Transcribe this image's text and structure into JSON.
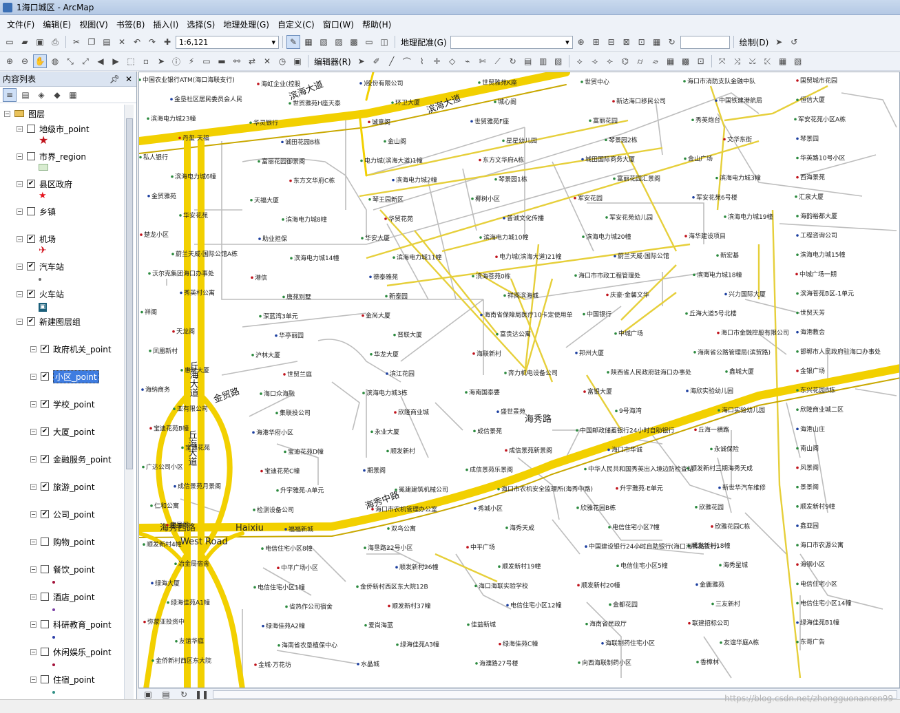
{
  "window": {
    "title": "1海口城区 - ArcMap"
  },
  "menu": [
    "文件(F)",
    "编辑(E)",
    "视图(V)",
    "书签(B)",
    "插入(I)",
    "选择(S)",
    "地理处理(G)",
    "自定义(C)",
    "窗口(W)",
    "帮助(H)"
  ],
  "toolbar": {
    "scale": "1:6,121",
    "georef_label": "地理配准(G)",
    "draw_label": "绘制(D)",
    "editor_label": "编辑器(R)"
  },
  "toc": {
    "title": "内容列表",
    "pin": "ᵠ",
    "close": "✕",
    "root": "图层",
    "layers": [
      {
        "name": "地级市_point",
        "checked": false,
        "symbol": "red-star"
      },
      {
        "name": "市界_region",
        "checked": false,
        "symbol": "green-rect"
      },
      {
        "name": "县区政府",
        "checked": true,
        "symbol": "red-star-small"
      },
      {
        "name": "乡镇",
        "checked": false,
        "symbol": "none"
      },
      {
        "name": "机场",
        "checked": true,
        "symbol": "airplane"
      },
      {
        "name": "汽车站",
        "checked": true,
        "symbol": "dot-gray"
      },
      {
        "name": "火车站",
        "checked": true,
        "symbol": "train"
      },
      {
        "name": "新建图层组",
        "checked": true,
        "symbol": "none"
      },
      {
        "name": "政府机关_point",
        "checked": true,
        "symbol": "none",
        "indent": true
      },
      {
        "name": "小区_point",
        "checked": true,
        "symbol": "none",
        "indent": true,
        "selected": true
      },
      {
        "name": "学校_point",
        "checked": true,
        "symbol": "none",
        "indent": true
      },
      {
        "name": "大厦_point",
        "checked": true,
        "symbol": "none",
        "indent": true
      },
      {
        "name": "金融服务_point",
        "checked": true,
        "symbol": "none",
        "indent": true
      },
      {
        "name": "旅游_point",
        "checked": true,
        "symbol": "none",
        "indent": true
      },
      {
        "name": "公司_point",
        "checked": true,
        "symbol": "none",
        "indent": true
      },
      {
        "name": "购物_point",
        "checked": false,
        "symbol": "none",
        "indent": true
      },
      {
        "name": "餐饮_point",
        "checked": false,
        "symbol": "dot-red",
        "indent": true
      },
      {
        "name": "酒店_point",
        "checked": false,
        "symbol": "dot-purple",
        "indent": true
      },
      {
        "name": "科研教育_point",
        "checked": false,
        "symbol": "dot-blue",
        "indent": true
      },
      {
        "name": "休闲娱乐_point",
        "checked": false,
        "symbol": "dot-red",
        "indent": true
      },
      {
        "name": "住宿_point",
        "checked": false,
        "symbol": "dot-teal",
        "indent": true
      },
      {
        "name": "高速",
        "checked": true,
        "symbol": "none"
      }
    ]
  },
  "map": {
    "road_labels": [
      {
        "text": "滨海大道",
        "rot": -22
      },
      {
        "text": "滨海大道",
        "rot": -22
      },
      {
        "text": "海秀中路",
        "rot": -20
      },
      {
        "text": "海秀西路",
        "rot": 0
      },
      {
        "text": "Haixiu",
        "rot": 0
      },
      {
        "text": "West Road",
        "rot": 0
      },
      {
        "text": "丘海大道",
        "rot": 90
      },
      {
        "text": "丘海大道",
        "rot": 90
      },
      {
        "text": "海秀路",
        "rot": 0
      },
      {
        "text": "金贸路",
        "rot": -20
      }
    ],
    "poi_labels": [
      "中国农业银行ATM(海口海联支行)",
      "海虹企业(控股",
      ")股份有限公司",
      "世贸雅苑K座",
      "世贸中心",
      "海口市消防支队金融中队",
      "国贸城市花园",
      "金垦社区居民委员会人民",
      "世贸雅苑H座天泰",
      "环卫大厦",
      "城心阁",
      "新达海口移民公司",
      "中国铁建港航局",
      "恒信大厦",
      "滨海电力城23幢",
      "华灵银行",
      "诚意阁",
      "世贸雅苑F座",
      "富丽花园",
      "秀英炮台",
      "军安花苑小区A栋",
      "丹玺·天福",
      "诚田花园B栋",
      "金山阁",
      "星星幼儿园",
      "琴景园2栋",
      "文华东街",
      "琴景园",
      "私人银行",
      "富丽花园御景阁",
      "电力城(滨海大道)1幢",
      "东方文华府A栋",
      "城田国际商务大厦",
      "金山广场",
      "华英路10号小区",
      "滨海电力城6幢",
      "东方文华府C栋",
      "滨海电力城2幢",
      "琴景园1栋",
      "富丽花园汇景阁",
      "滨海电力城3幢",
      "西海景苑",
      "金贸雅苑",
      "天福大厦",
      "琴王园新区",
      "椰树小区",
      "军安花园",
      "军安花苑6号楼",
      "汇泉大厦",
      "华安花苑",
      "滨海电力城8幢",
      "华贸花苑",
      "普诚文化传播",
      "军安花苑幼儿园",
      "滨海电力城19幢",
      "海韵裕都大厦",
      "楚龙小区",
      "助业担保",
      "华安大厦",
      "滨海电力城10幢",
      "滨海电力城20幢",
      "海华建设项目",
      "工程咨询公司",
      "蔚兰天威·国际公馆A栋",
      "滨海电力城14幢",
      "滨海电力城11幢",
      "电力城(滨海大道)21幢",
      "蔚兰天威·国际公馆",
      "新宏基",
      "滨海电力城15幢",
      "沃尔克集团海口办事处",
      "港信",
      "德泰雅苑",
      "滨海苍苑0栋",
      "海口市市政工程管理处",
      "滨海电力城18幢",
      "中城广场一期",
      "秀英村公寓",
      "唐苑别墅",
      "新泰园",
      "祥阁滨海城",
      "庆豪·金馨文华",
      "兴力国际大厦",
      "滨海苍苑B区-1单元",
      "祥阁",
      "深蓝湾3单元",
      "金尚大厦",
      "海南省保障局医疗10卡定使用单",
      "中国银行",
      "丘海大道5号北楼",
      "世贸天芳",
      "天龙阁",
      "华亭丽园",
      "晋联大厦",
      "富贵达公寓",
      "中城广场",
      "海口市金融控股有限公司",
      "海港教会",
      "凤凰新村",
      "沪林大厦",
      "华龙大厦",
      "海联新村",
      "邦州大厦",
      "海南省公路管理局(滨贸路)",
      "邯郸市人民政府驻海口办事处",
      "惠财大厦",
      "世贸兰庭",
      "滨江花园",
      "奔力机电设备公司",
      "陕西省人民政府驻海口办事处",
      "鑫城大厦",
      "金银广场",
      "海纳商务",
      "海口众海融",
      "滨海电力城3栋",
      "海南国泰要",
      "富银大厦",
      "海欣实验幼儿园",
      "东兴花园B栋",
      "亚有限公司",
      "集联投公司",
      "欣隆商业城",
      "盛世景苑",
      "9号海湾",
      "海口实验幼儿园",
      "欣隆商业城二区",
      "宝迪花苑B幢",
      "海港华府小区",
      "永业大厦",
      "成信景苑",
      "中国邮政储蓄银行24小时自助银行",
      "丘海一横路",
      "海港山庄",
      "宝迪花苑",
      "宝迪花苑D幢",
      "顺发新村",
      "成信景苑新景阁",
      "海口市华诚",
      "永诚保险",
      "南山阁",
      "广达公司小区",
      "宝迪花苑C幢",
      "期景阁",
      "成信景苑乐景阁",
      "中华人民共和国秀英出入境边防检查站",
      "顺发新村三期海秀天成",
      "风景阁",
      "成信景苑月景阁",
      "升宇雅苑-A单元",
      "冕建建筑机械公司",
      "海口市农机安全监理所(海秀中路)",
      "升宇雅苑-E单元",
      "新世华汽车维修",
      "景景阁",
      "仁和公寓",
      "检测设备公司",
      "海口市农机管理办公室",
      "秀城小区",
      "欣雅花园B栋",
      "欣雅花园",
      "顺发新村9幢",
      "唐星阁",
      "福福新城",
      "双鸟公寓",
      "海秀天成",
      "电信住宅小区7幢",
      "欣雅花园C栋",
      "鑫亚园",
      "顺发新村4幢",
      "电信住宅小区8幢",
      "海垦路22号小区",
      "中平广场",
      "中国建设银行24小时自助银行(海口海秀路支行)",
      "顺发新村18幢",
      "海口市农源公寓",
      "冶金局宿舍",
      "中平广场小区",
      "顺发新村26幢",
      "顺发新村19幢",
      "电信住宅小区5幢",
      "海秀星城",
      "海钢小区",
      "绿海大厦",
      "电信住宅小区1幢",
      "金侨新村西区东大院12B",
      "海口海联实验学校",
      "顺发新村20幢",
      "金鹿雅苑",
      "电信住宅小区",
      "绿海佳苑A1幢",
      "省热作公司宿舍",
      "顺发新村37幢",
      "电信住宅小区12幢",
      "金都花园",
      "三友新村",
      "电信住宅小区14幢",
      "弥蒙亚投资中",
      "绿海佳苑A2幢",
      "爱尚海蓝",
      "佳益新城",
      "海南省民政厅",
      "联建招标公司",
      "绿海佳苑B1幢",
      "友谊华庭",
      "海南省农垦植保中心",
      "绿海佳苑A3幢",
      "绿海佳苑C幢",
      "海联制药住宅小区",
      "友谊华庭A栋",
      "东哥广告",
      "金侨新村西区东大院",
      "金城·万花坊",
      "水晶城",
      "海濮路27号楼",
      "向西海联制药小区",
      "香樟林"
    ]
  },
  "status": {
    "watermark": "https://blog.csdn.net/zhongguonanren99"
  }
}
